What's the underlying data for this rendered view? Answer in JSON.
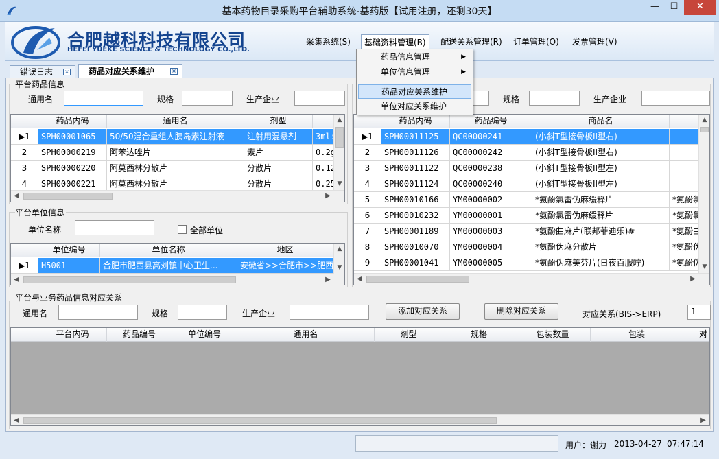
{
  "window": {
    "title": "基本药物目录采购平台辅助系统-基药版【试用注册，还剩30天】",
    "minimize": "—",
    "maximize": "☐",
    "close": "✕"
  },
  "company": {
    "name_cn": "合肥越科科技有限公司",
    "name_en": "HEFEI YUEKE SCIENCE & TECHNOLOGY CO.,LTD."
  },
  "menu": [
    {
      "label": "采集系统(S)"
    },
    {
      "label": "基础资料管理(B)"
    },
    {
      "label": "配送关系管理(R)"
    },
    {
      "label": "订单管理(O)"
    },
    {
      "label": "发票管理(V)"
    }
  ],
  "dropdown": [
    {
      "label": "药品信息管理",
      "arrow": "▶"
    },
    {
      "label": "单位信息管理",
      "arrow": "▶"
    },
    {
      "label": "药品对应关系维护"
    },
    {
      "label": "单位对应关系维护"
    }
  ],
  "tabs": [
    {
      "label": "错误日志",
      "close": "×"
    },
    {
      "label": "药品对应关系维护",
      "close": "×"
    }
  ],
  "platform_drug": {
    "title": "平台药品信息",
    "generic_name_label": "通用名",
    "spec_label": "规格",
    "manufacturer_label": "生产企业",
    "columns": [
      "药品内码",
      "通用名",
      "剂型",
      ""
    ],
    "rows": [
      {
        "n": "▶1",
        "code": "SPH00001065",
        "name": "50/50混合重组人胰岛素注射液",
        "form": "注射用混悬剂",
        "spec": "3ml:"
      },
      {
        "n": "2",
        "code": "SPH00000219",
        "name": "阿苯达唑片",
        "form": "素片",
        "spec": "0.2g"
      },
      {
        "n": "3",
        "code": "SPH00000220",
        "name": "阿莫西林分散片",
        "form": "分散片",
        "spec": "0.12"
      },
      {
        "n": "4",
        "code": "SPH00000221",
        "name": "阿莫西林分散片",
        "form": "分散片",
        "spec": "0.25"
      }
    ]
  },
  "platform_unit": {
    "title": "平台单位信息",
    "unit_name_label": "单位名称",
    "all_units_label": "全部单位",
    "columns": [
      "单位编号",
      "单位名称",
      "地区"
    ],
    "rows": [
      {
        "n": "▶1",
        "code": "H5001",
        "name": "合肥市肥西县高刘镇中心卫生...",
        "region": "安徽省>>合肥市>>肥西"
      }
    ]
  },
  "business_drug": {
    "spec_label": "规格",
    "manufacturer_label": "生产企业",
    "columns": [
      "药品内码",
      "药品编号",
      "商品名",
      ""
    ],
    "rows": [
      {
        "n": "▶1",
        "code": "SPH00011125",
        "num": "QC00000241",
        "name": "(小斜T型接骨板II型右)",
        "extra": ""
      },
      {
        "n": "2",
        "code": "SPH00011126",
        "num": "QC00000242",
        "name": "(小斜T型接骨板II型右)",
        "extra": ""
      },
      {
        "n": "3",
        "code": "SPH00011122",
        "num": "QC00000238",
        "name": "(小斜T型接骨板II型左)",
        "extra": ""
      },
      {
        "n": "4",
        "code": "SPH00011124",
        "num": "QC00000240",
        "name": "(小斜T型接骨板II型左)",
        "extra": ""
      },
      {
        "n": "5",
        "code": "SPH00010166",
        "num": "YM00000002",
        "name": "*氨酚氯雷伪麻缓释片",
        "extra": "*氨酚氯"
      },
      {
        "n": "6",
        "code": "SPH00010232",
        "num": "YM00000001",
        "name": "*氨酚氯雷伪麻缓释片",
        "extra": "*氨酚氯"
      },
      {
        "n": "7",
        "code": "SPH00001189",
        "num": "YM00000003",
        "name": "*氨酚曲麻片(联邦菲迪乐)#",
        "extra": "*氨酚曲"
      },
      {
        "n": "8",
        "code": "SPH00010070",
        "num": "YM00000004",
        "name": "*氨酚伪麻分散片",
        "extra": "*氨酚伪"
      },
      {
        "n": "9",
        "code": "SPH00001041",
        "num": "YM00000005",
        "name": "*氨酚伪麻美芬片(日夜百服咛)",
        "extra": "*氨酚伪"
      }
    ]
  },
  "relation": {
    "title": "平台与业务药品信息对应关系",
    "generic_name_label": "通用名",
    "spec_label": "规格",
    "manufacturer_label": "生产企业",
    "add_button": "添加对应关系",
    "delete_button": "删除对应关系",
    "mapping_label": "对应关系(BIS->ERP)",
    "mapping_value": "1",
    "columns": [
      "平台内码",
      "药品编号",
      "单位编号",
      "通用名",
      "剂型",
      "规格",
      "包装数量",
      "包装",
      "对"
    ]
  },
  "status": {
    "user": "用户：谢力",
    "date": "2013-04-27",
    "time": "07:47:14"
  },
  "scroll": {
    "up": "▲",
    "down": "▼",
    "left": "◀",
    "right": "▶"
  },
  "colors": {
    "selection": "#3399ff",
    "brand": "#14448f",
    "close": "#c7463a"
  }
}
